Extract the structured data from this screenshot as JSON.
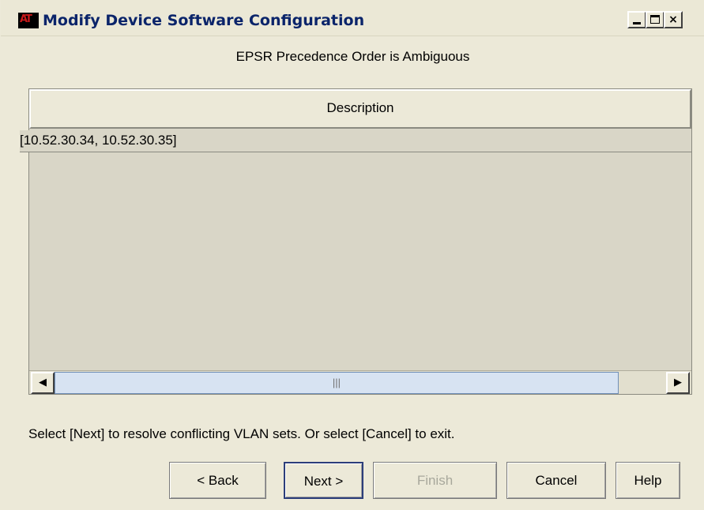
{
  "window": {
    "title": "Modify Device Software Configuration",
    "logo_text": "AT",
    "controls": {
      "minimize": "_",
      "maximize": "□",
      "close": "×"
    }
  },
  "heading": "EPSR Precedence Order is Ambiguous",
  "table": {
    "columns": [
      "Description"
    ],
    "rows": [
      [
        "[10.52.30.34, 10.52.30.35]"
      ]
    ],
    "scroll": {
      "left_arrow": "◀",
      "right_arrow": "▶",
      "thumb_grip": "|||"
    }
  },
  "instructions": "Select [Next] to resolve conflicting VLAN sets. Or select [Cancel] to exit.",
  "buttons": {
    "back": "< Back",
    "next": "Next >",
    "finish": "Finish",
    "cancel": "Cancel",
    "help": "Help"
  }
}
